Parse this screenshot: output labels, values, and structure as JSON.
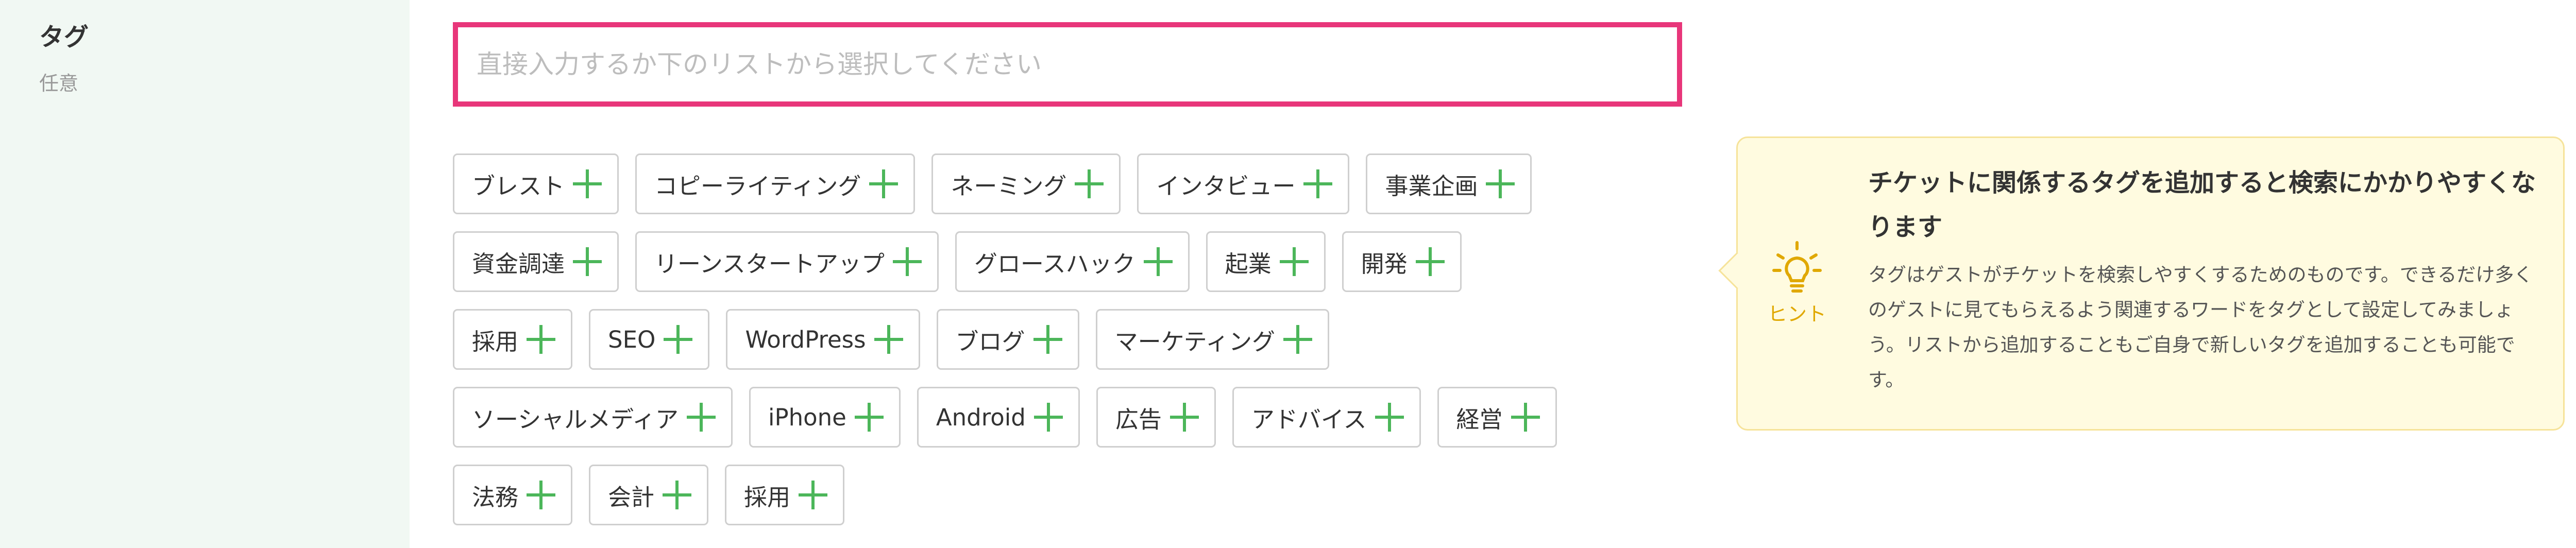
{
  "field": {
    "title": "タグ",
    "subtitle": "任意"
  },
  "tag_input": {
    "value": "",
    "placeholder": "直接入力するか下のリストから選択してください"
  },
  "tag_rows": [
    [
      "ブレスト",
      "コピーライティング",
      "ネーミング",
      "インタビュー",
      "事業企画"
    ],
    [
      "資金調達",
      "リーンスタートアップ",
      "グロースハック",
      "起業",
      "開発"
    ],
    [
      "採用",
      "SEO",
      "WordPress",
      "ブログ",
      "マーケティング"
    ],
    [
      "ソーシャルメディア",
      "iPhone",
      "Android",
      "広告",
      "アドバイス",
      "経営"
    ],
    [
      "法務",
      "会計",
      "採用"
    ]
  ],
  "hint": {
    "icon": "lightbulb-icon",
    "icon_label": "ヒント",
    "title": "チケットに関係するタグを追加すると検索にかかりやすくなります",
    "body": "タグはゲストがチケットを検索しやすくするためのものです。できるだけ多くのゲストに見てもらえるよう関連するワードをタグとして設定してみましょう。リストから追加することもご自身で新しいタグを追加することも可能です。"
  },
  "colors": {
    "accent_border": "#e8367a",
    "plus_green": "#4cb65a",
    "label_bg": "#f1f8f3",
    "hint_bg": "#fffbe0",
    "hint_border": "#f6e39a",
    "hint_icon": "#e0a800"
  }
}
